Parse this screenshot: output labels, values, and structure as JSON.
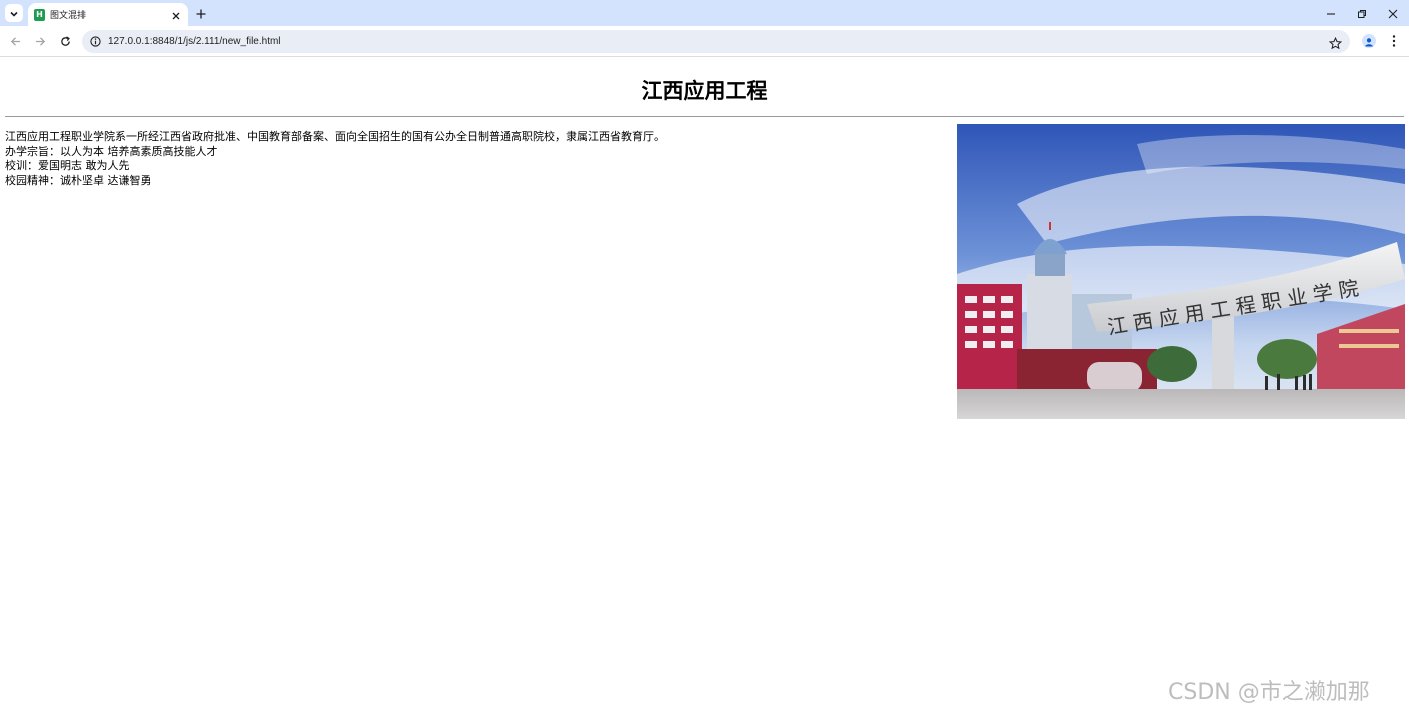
{
  "browser": {
    "tab": {
      "title": "图文混排",
      "favicon": "H"
    },
    "url": "127.0.0.1:8848/1/js/2.111/new_file.html",
    "colors": {
      "tabstrip": "#d3e3fd",
      "omnibox": "#e9eef6"
    }
  },
  "page": {
    "heading": "江西应用工程",
    "paragraphs": [
      "江西应用工程职业学院系一所经江西省政府批准、中国教育部备案、面向全国招生的国有公办全日制普通高职院校，隶属江西省教育厅。",
      "办学宗旨：以人为本 培养高素质高技能人才",
      "校训：爱国明志 敢为人先",
      "校园精神：诚朴坚卓 达谦智勇"
    ],
    "photo": {
      "gate_sign": "江西应用工程职业学院"
    }
  },
  "watermark": "CSDN @市之濑加那"
}
